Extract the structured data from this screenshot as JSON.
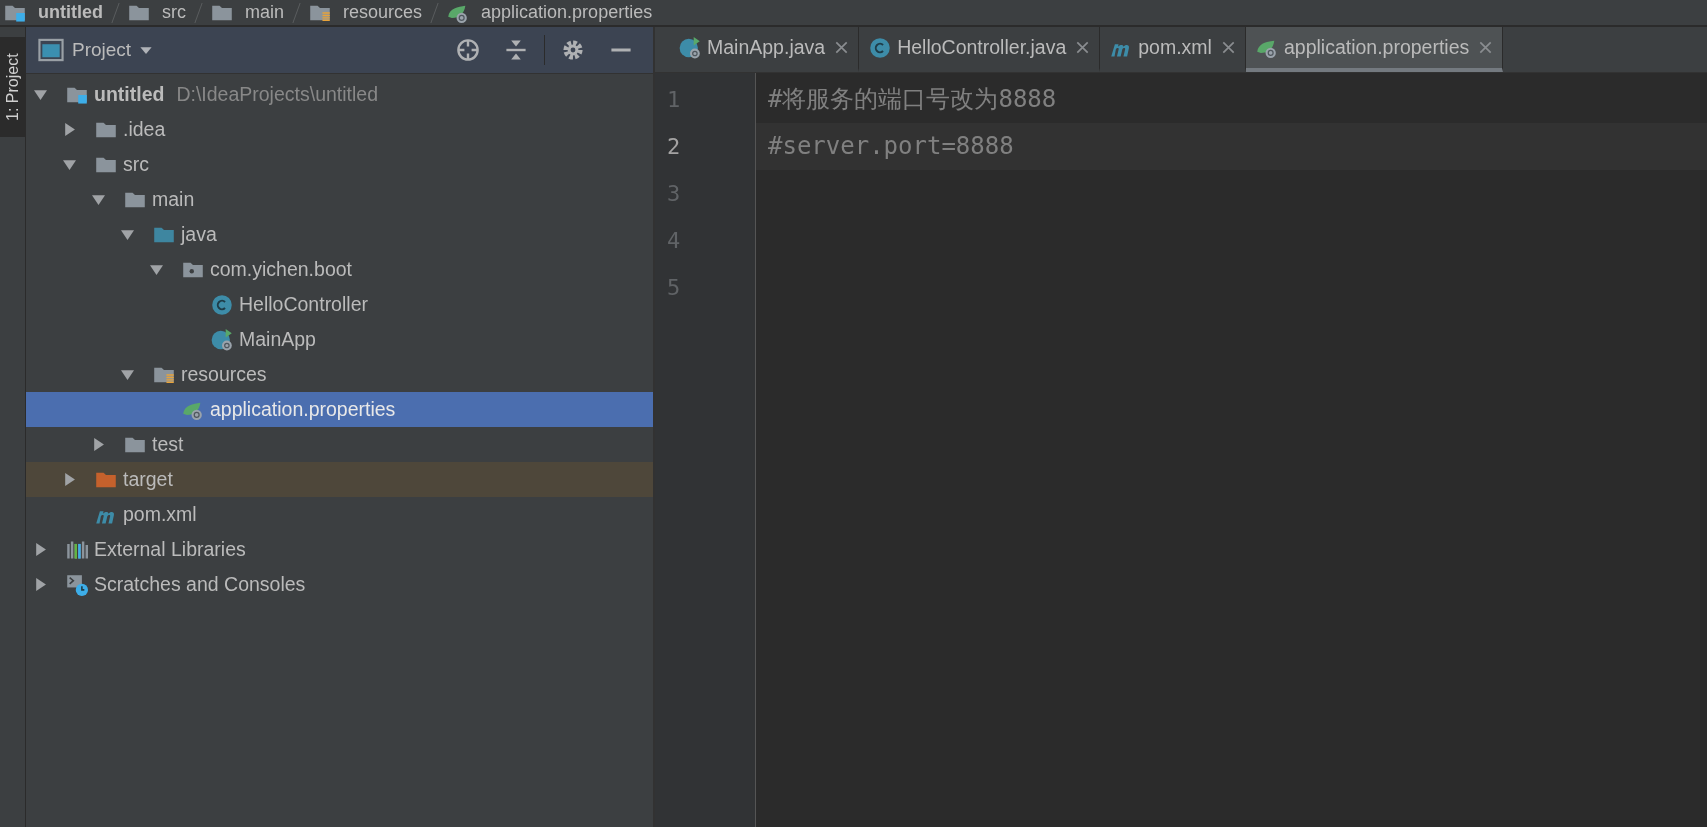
{
  "breadcrumbs": [
    {
      "label": "untitled",
      "kind": "module"
    },
    {
      "label": "src",
      "kind": "folder"
    },
    {
      "label": "main",
      "kind": "folder"
    },
    {
      "label": "resources",
      "kind": "resources"
    },
    {
      "label": "application.properties",
      "kind": "spring"
    }
  ],
  "side_stripe": {
    "label": "1: Project"
  },
  "project_panel": {
    "title": "Project",
    "tree": [
      {
        "label": "untitled",
        "path": "D:\\IdeaProjects\\untitled",
        "kind": "module",
        "expanded": true,
        "selected": false,
        "excluded": false,
        "children": [
          {
            "label": ".idea",
            "kind": "folder",
            "expanded": false,
            "selected": false,
            "excluded": false
          },
          {
            "label": "src",
            "kind": "folder",
            "expanded": true,
            "selected": false,
            "excluded": false,
            "children": [
              {
                "label": "main",
                "kind": "folder",
                "expanded": true,
                "selected": false,
                "excluded": false,
                "children": [
                  {
                    "label": "java",
                    "kind": "source",
                    "expanded": true,
                    "selected": false,
                    "excluded": false,
                    "children": [
                      {
                        "label": "com.yichen.boot",
                        "kind": "package",
                        "expanded": true,
                        "selected": false,
                        "excluded": false,
                        "children": [
                          {
                            "label": "HelloController",
                            "kind": "class",
                            "selected": false,
                            "excluded": false
                          },
                          {
                            "label": "MainApp",
                            "kind": "springclass",
                            "selected": false,
                            "excluded": false
                          }
                        ]
                      }
                    ]
                  },
                  {
                    "label": "resources",
                    "kind": "resources",
                    "expanded": true,
                    "selected": false,
                    "excluded": false,
                    "children": [
                      {
                        "label": "application.properties",
                        "kind": "spring",
                        "selected": true,
                        "excluded": false
                      }
                    ]
                  }
                ]
              },
              {
                "label": "test",
                "kind": "folder",
                "expanded": false,
                "selected": false,
                "excluded": false
              }
            ]
          },
          {
            "label": "target",
            "kind": "excluded",
            "expanded": false,
            "selected": false,
            "excluded": true
          },
          {
            "label": "pom.xml",
            "kind": "maven",
            "selected": false,
            "excluded": false
          }
        ]
      },
      {
        "label": "External Libraries",
        "kind": "libraries",
        "expanded": false,
        "selected": false,
        "excluded": false
      },
      {
        "label": "Scratches and Consoles",
        "kind": "scratches",
        "expanded": false,
        "selected": false,
        "excluded": false
      }
    ]
  },
  "editor": {
    "tabs": [
      {
        "label": "MainApp.java",
        "kind": "springclass",
        "selected": false
      },
      {
        "label": "HelloController.java",
        "kind": "class",
        "selected": false
      },
      {
        "label": "pom.xml",
        "kind": "maven",
        "selected": false
      },
      {
        "label": "application.properties",
        "kind": "spring",
        "selected": true
      }
    ],
    "lines": [
      {
        "number": "1",
        "text": "#将服务的端口号改为8888",
        "current": false
      },
      {
        "number": "2",
        "text": "#server.port=8888",
        "current": true
      },
      {
        "number": "3",
        "current": false
      },
      {
        "number": "4",
        "current": false
      },
      {
        "number": "5",
        "current": false
      }
    ]
  }
}
